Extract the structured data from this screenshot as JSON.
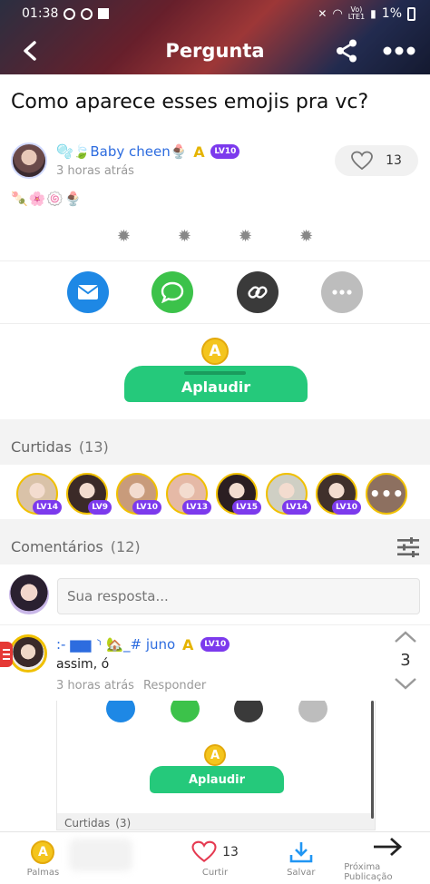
{
  "status": {
    "time": "01:38",
    "battery": "1%",
    "carrier_top": "Vo)",
    "carrier_bottom": "LTE1"
  },
  "nav": {
    "title": "Pergunta"
  },
  "post": {
    "title": "Como aparece esses emojis pra vc?",
    "author": "🫧🍃Baby cheen🍨",
    "author_level": "LV10",
    "time": "3 horas atrás",
    "likes": "13",
    "body": "🍡🌸🍥🍨"
  },
  "props": {
    "coin": "A",
    "button_label": "Aplaudir"
  },
  "likes_section": {
    "title": "Curtidas",
    "count": "(13)"
  },
  "likers": [
    {
      "level": "LV14",
      "color": "#d9c2a8"
    },
    {
      "level": "LV9",
      "color": "#3b2a28"
    },
    {
      "level": "LV10",
      "color": "#c89b7b"
    },
    {
      "level": "LV13",
      "color": "#e5b9a6"
    },
    {
      "level": "LV15",
      "color": "#2b1e22"
    },
    {
      "level": "LV14",
      "color": "#cfcfc4"
    },
    {
      "level": "LV10",
      "color": "#40302c"
    }
  ],
  "comments_section": {
    "title": "Comentários",
    "count": "(12)"
  },
  "reply": {
    "placeholder": "Sua resposta..."
  },
  "comment": {
    "author": ":- ▆▆ ⸃ 🏡_# juno",
    "author_level": "LV10",
    "text": "assim, ó",
    "time": "3 horas atrás",
    "reply_label": "Responder",
    "votes": "3"
  },
  "screenshot_embed": {
    "button_label": "Aplaudir",
    "coin": "A",
    "section_title": "Curtidas",
    "section_count": "(3)"
  },
  "bottom_bar": {
    "props_label": "Palmas",
    "like_label": "Curtir",
    "like_count": "13",
    "save_label": "Salvar",
    "next_label": "Próxima Publicação"
  },
  "colors": {
    "accent_green": "#25c97b",
    "link_blue": "#2d6cdf",
    "level_purple": "#7c3aed",
    "coin_gold": "#f4c51d"
  }
}
